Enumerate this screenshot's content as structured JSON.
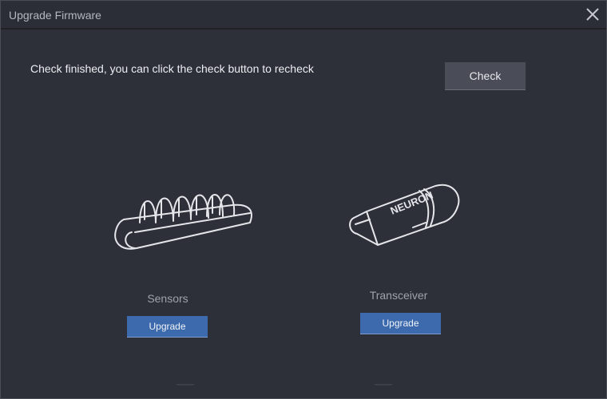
{
  "window": {
    "title": "Upgrade Firmware",
    "close_icon": "close-icon"
  },
  "check": {
    "status_text": "Check finished, you can click the check button to recheck",
    "button_label": "Check"
  },
  "devices": [
    {
      "label": "Sensors",
      "icon": "sensor-dock-icon",
      "upgrade_label": "Upgrade"
    },
    {
      "label": "Transceiver",
      "icon": "usb-transceiver-icon",
      "upgrade_label": "Upgrade",
      "brand_text": "NEURON"
    }
  ],
  "colors": {
    "background": "#2d3039",
    "button_gray": "#4a4d57",
    "button_blue": "#3d6aad"
  }
}
